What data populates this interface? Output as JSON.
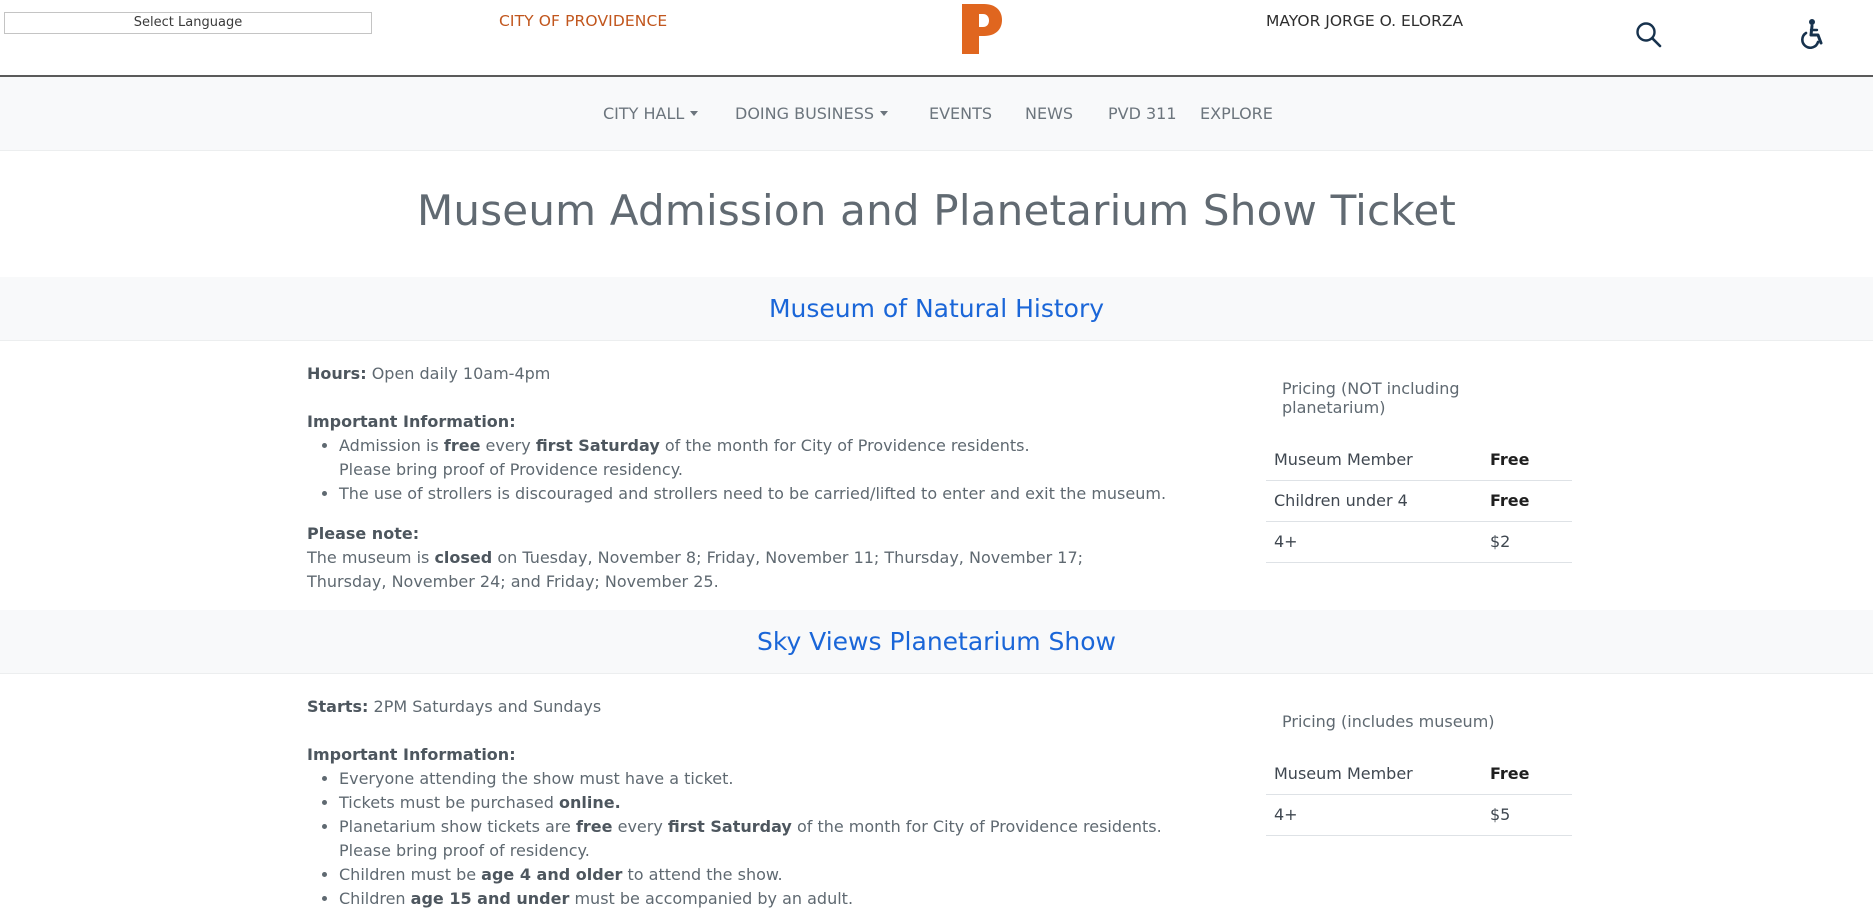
{
  "header": {
    "language_select": "Select Language",
    "city_link": "CITY OF PROVIDENCE",
    "logo_letter": "P",
    "mayor_link": "MAYOR JORGE O. ELORZA",
    "search_icon": "search-icon",
    "accessibility_icon": "accessibility-icon",
    "brand_color": "#e0661f"
  },
  "nav": {
    "items": [
      {
        "label": "CITY HALL",
        "has_dropdown": true
      },
      {
        "label": "DOING BUSINESS",
        "has_dropdown": true
      },
      {
        "label": "EVENTS",
        "has_dropdown": false
      },
      {
        "label": "NEWS",
        "has_dropdown": false
      },
      {
        "label": "PVD 311",
        "has_dropdown": false
      },
      {
        "label": "EXPLORE",
        "has_dropdown": false
      }
    ]
  },
  "page_title": "Museum Admission and Planetarium Show Ticket",
  "museum": {
    "heading": "Museum of Natural History",
    "hours_label": "Hours:",
    "hours_value": "Open daily 10am-4pm",
    "important_label": "Important Information:",
    "bullet1_pre": "Admission is",
    "bullet1_free": "free",
    "bullet1_mid": "every",
    "bullet1_first_saturday": "first Saturday",
    "bullet1_post": "of the month for City of Providence residents.",
    "bullet1_line2": "Please bring proof of Providence residency.",
    "bullet2": "The use of strollers is discouraged and strollers need to be carried/lifted to enter and exit the museum.",
    "note_label": "Please note:",
    "note_pre": "The museum is",
    "note_closed": "closed",
    "note_post": "on Tuesday, November 8; Friday, November 11; Thursday, November 17; Thursday, November 24; and Friday; November 25.",
    "pricing_caption": "Pricing (NOT including planetarium)",
    "pricing_rows": [
      {
        "name": "Museum Member",
        "price": "Free"
      },
      {
        "name": "Children under 4",
        "price": "Free"
      },
      {
        "name": "4+",
        "price": "$2"
      }
    ]
  },
  "planetarium": {
    "heading": "Sky Views Planetarium Show",
    "starts_label": "Starts:",
    "starts_value": "2PM Saturdays and Sundays",
    "important_label": "Important Information:",
    "bullet1": "Everyone attending the show must have a ticket.",
    "bullet2_pre": "Tickets must be purchased",
    "bullet2_bold": "online.",
    "bullet3_pre": "Planetarium show tickets are",
    "bullet3_free": "free",
    "bullet3_mid": "every",
    "bullet3_first_saturday": "first Saturday",
    "bullet3_post": "of the month for City of Providence residents.",
    "bullet3_line2": "Please bring proof of residency.",
    "bullet4_pre": "Children must be",
    "bullet4_bold": "age 4 and older",
    "bullet4_post": "to attend the show.",
    "bullet5_pre": "Children",
    "bullet5_bold": "age 15 and under",
    "bullet5_post": "must be accompanied by an adult.",
    "pricing_caption": "Pricing (includes museum)",
    "pricing_rows": [
      {
        "name": "Museum Member",
        "price": "Free"
      },
      {
        "name": "4+",
        "price": "$5"
      }
    ]
  }
}
